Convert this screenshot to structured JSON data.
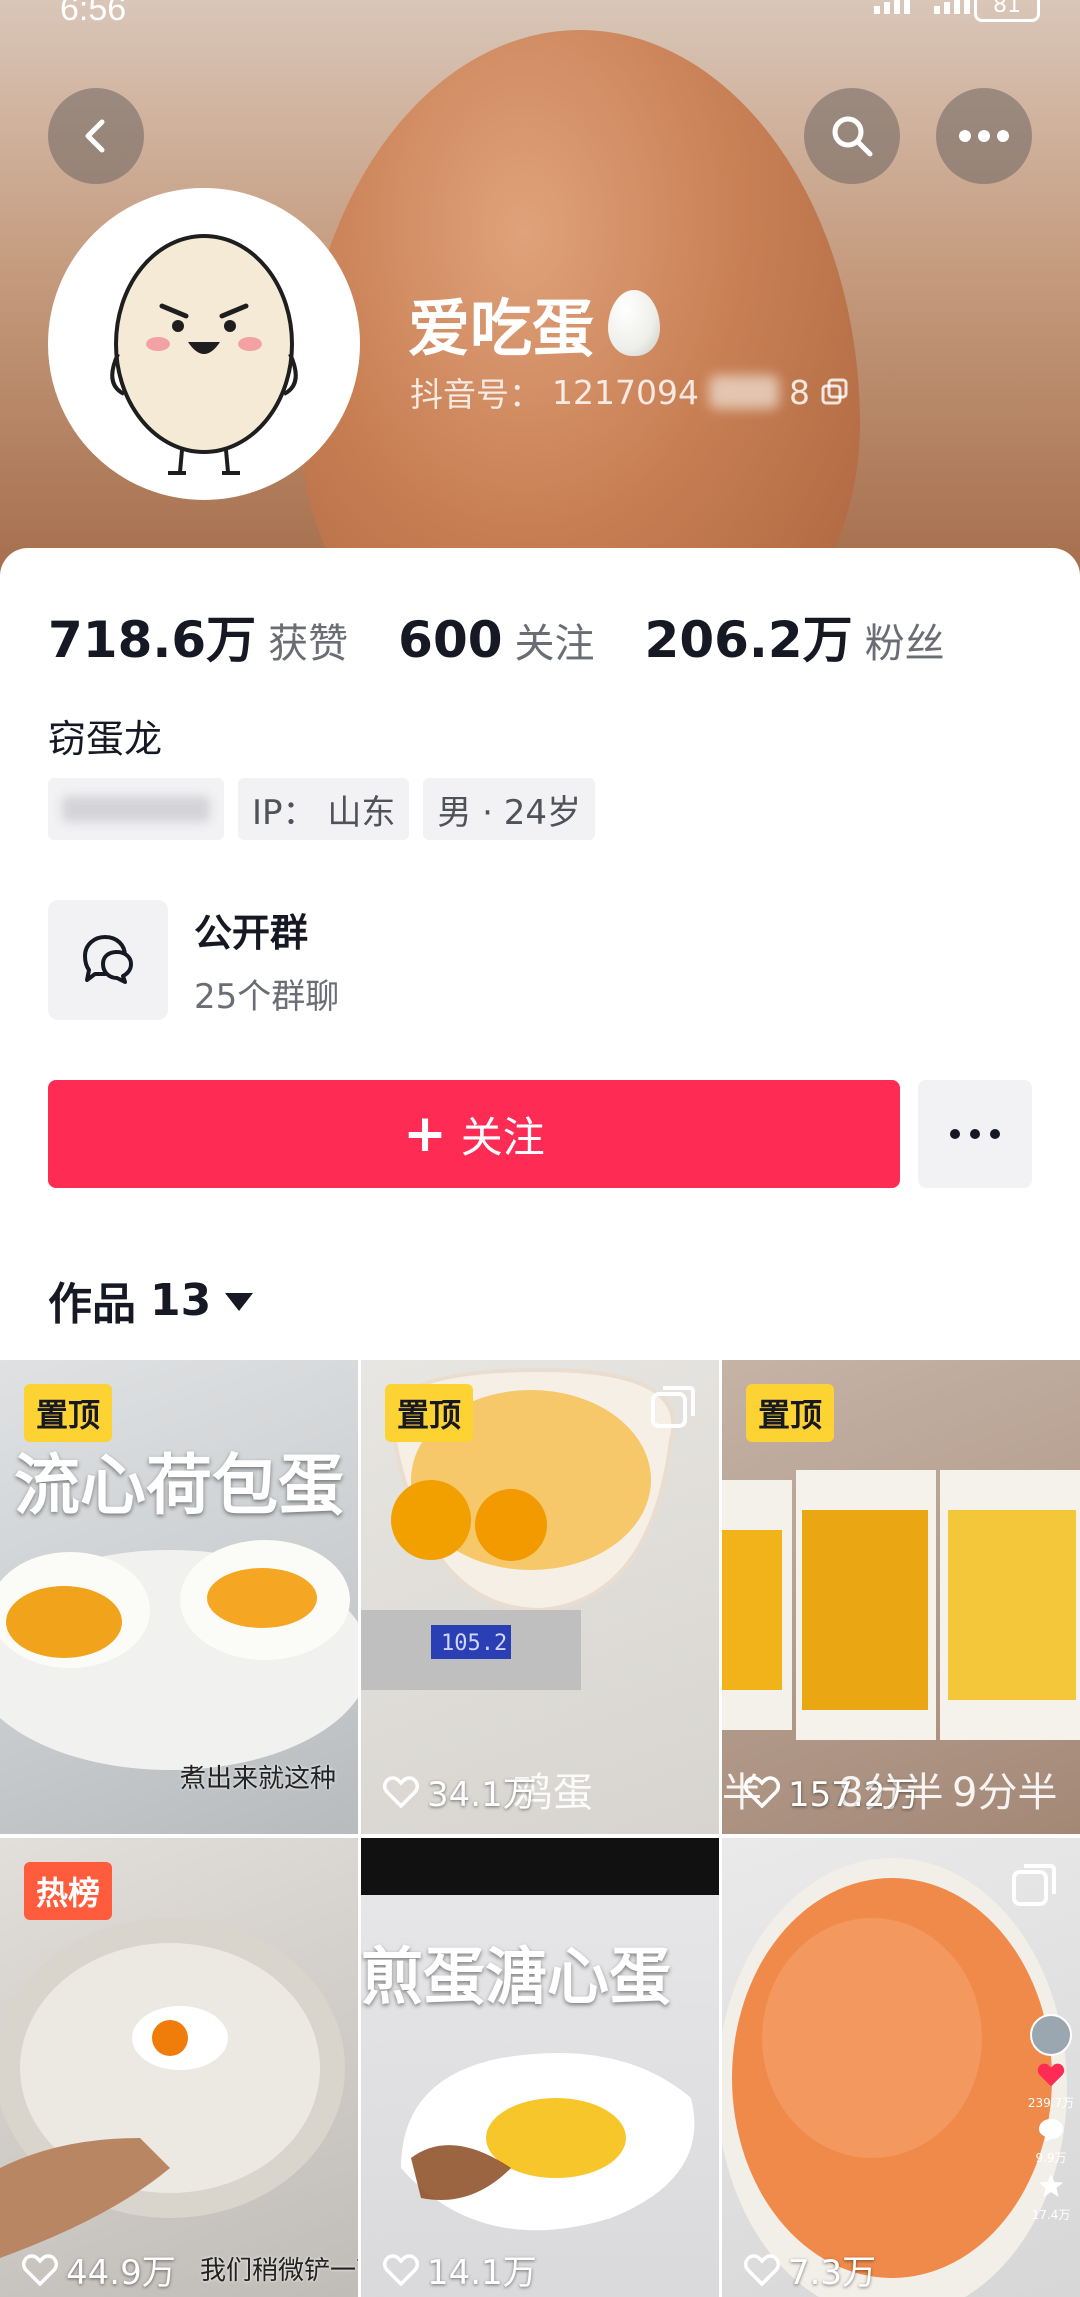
{
  "status_bar": {
    "time": "6:56",
    "battery": "81"
  },
  "profile": {
    "nickname": "爱吃蛋",
    "douyin_id_label": "抖音号：",
    "douyin_id": "1217094",
    "douyin_id_tail": "8",
    "stats": [
      {
        "value": "718.6万",
        "label": "获赞"
      },
      {
        "value": "600",
        "label": "关注"
      },
      {
        "value": "206.2万",
        "label": "粉丝"
      }
    ],
    "bio": "窃蛋龙",
    "tags": {
      "ip": "IP：  山东",
      "gender_age": "男 · 24岁"
    }
  },
  "group": {
    "title": "公开群",
    "subtitle": "25个群聊"
  },
  "actions": {
    "follow_label": "关注"
  },
  "works": {
    "label": "作品",
    "count": "13"
  },
  "videos": [
    {
      "badge": "置顶",
      "caption": "流心荷包蛋",
      "subcaption": "煮出来就这种",
      "likes": ""
    },
    {
      "badge": "置顶",
      "caption": "鸡蛋",
      "scale_reading": "105.2",
      "likes": "34.1万",
      "multi_image": true
    },
    {
      "badge": "置顶",
      "caption_left": "半",
      "caption_mid": "8分半",
      "caption_right": "9分半",
      "likes": "157.2万"
    },
    {
      "badge": "热榜",
      "subcaption": "我们稍微铲一下",
      "likes": "44.9万"
    },
    {
      "badge": "",
      "caption": "煎蛋溏心蛋",
      "likes": "14.1万"
    },
    {
      "badge": "",
      "likes": "7.3万",
      "multi_image": true,
      "side_likes": "239.7万",
      "side_comments": "9.9万",
      "side_favorites": "17.4万"
    }
  ],
  "colors": {
    "accent": "#fe2c55",
    "pin_badge": "#fdd233",
    "hot_badge": "#fe5c3d"
  }
}
